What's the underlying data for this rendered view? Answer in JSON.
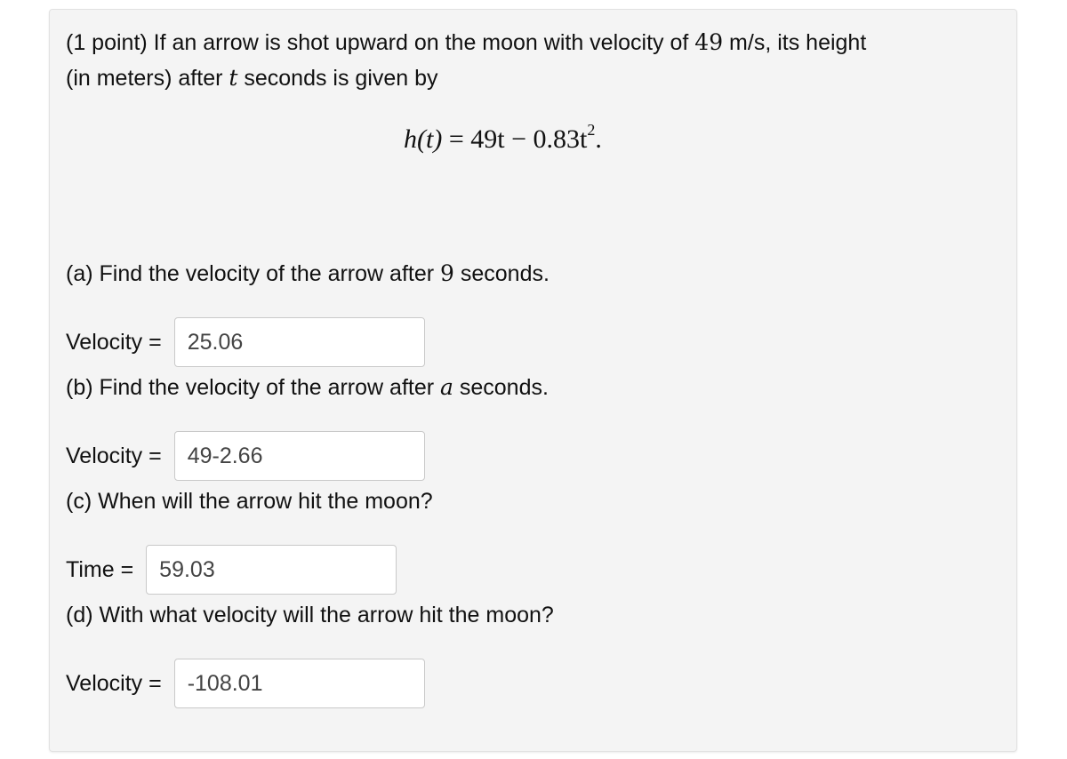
{
  "problem": {
    "intro_line1_a": "(1 point) If an arrow is shot upward on the moon with velocity of ",
    "intro_velocity": "49",
    "intro_line1_b": " m/s, its height",
    "intro_line2_a": "(in meters) after ",
    "intro_var": "t",
    "intro_line2_b": " seconds is given by",
    "formula": {
      "lhs": "h(t)",
      "eq": " = ",
      "rhs_a": "49t − 0.83t",
      "exp": "2",
      "end": "."
    }
  },
  "parts": [
    {
      "question_a": "(a) Find the velocity of the arrow after ",
      "question_var": "9",
      "question_b": " seconds.",
      "label": "Velocity =",
      "value": "25.06"
    },
    {
      "question_a": "(b) Find the velocity of the arrow after ",
      "question_var": "a",
      "question_b": " seconds.",
      "label": "Velocity =",
      "value": "49-2.66"
    },
    {
      "question_a": "(c) When will the arrow hit the moon?",
      "label": "Time =",
      "value": "59.03"
    },
    {
      "question_a": "(d) With what velocity will the arrow hit the moon?",
      "label": "Velocity =",
      "value": "-108.01"
    }
  ]
}
